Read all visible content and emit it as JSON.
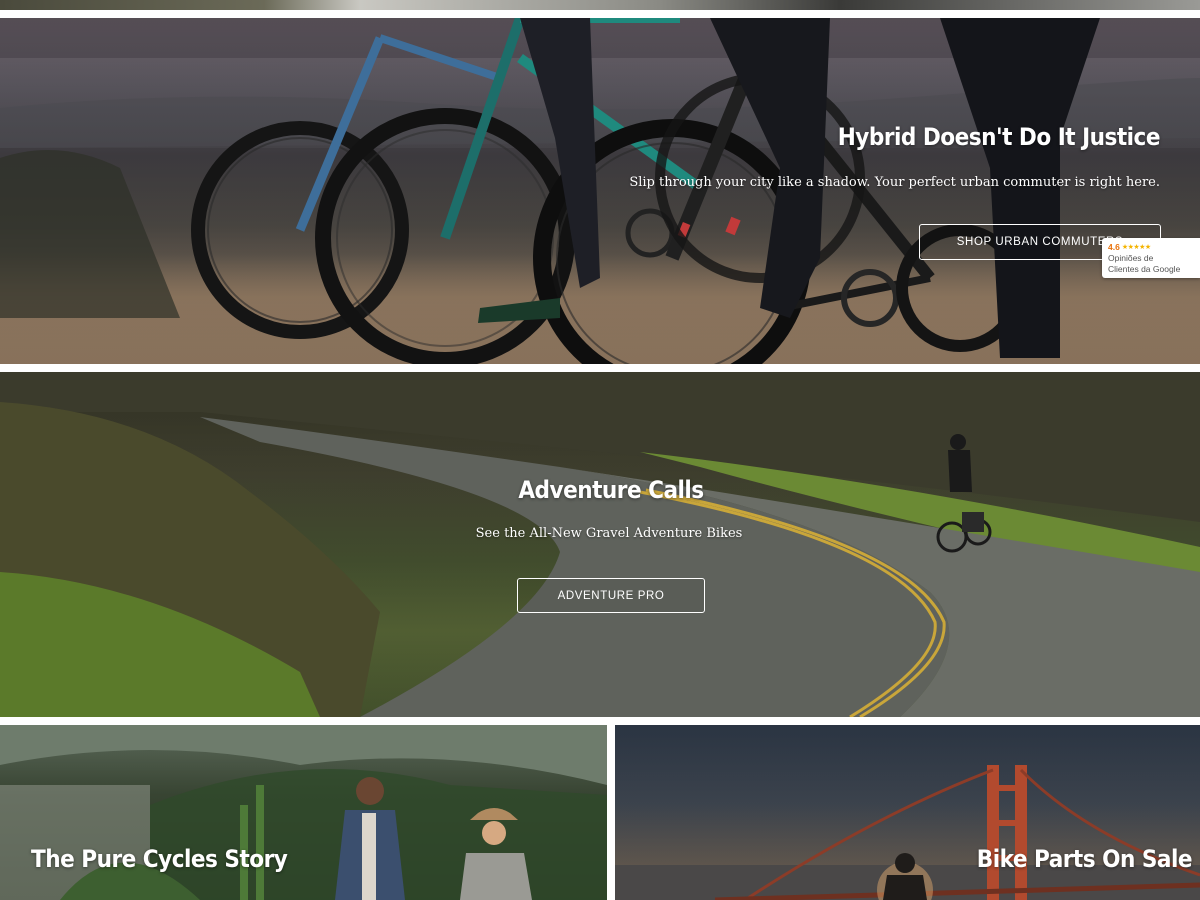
{
  "hero_urban": {
    "title": "Hybrid Doesn't Do It Justice",
    "subtitle": "Slip through your city like a shadow. Your perfect urban commuter is right here.",
    "cta_label": "SHOP URBAN COMMUTERS"
  },
  "google_badge": {
    "rating": "4.6",
    "stars": "★★★★★",
    "line1": "Opiniões de",
    "line2": "Clientes da Google"
  },
  "hero_adventure": {
    "title": "Adventure Calls",
    "subtitle": "See the All-New Gravel Adventure Bikes",
    "cta_label": "ADVENTURE PRO"
  },
  "tile_story": {
    "title": "The Pure Cycles Story"
  },
  "tile_parts": {
    "title": "Bike Parts On Sale"
  },
  "colors": {
    "cta_border": "#ffffff",
    "heading_text": "#ffffff",
    "rating_orange": "#e8710a",
    "star_yellow": "#f4b400"
  }
}
